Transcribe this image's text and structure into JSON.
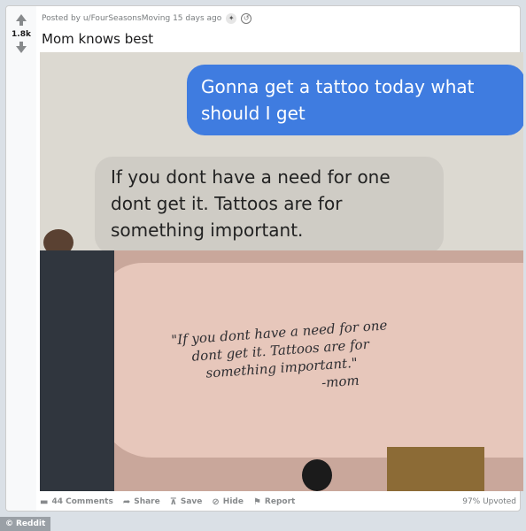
{
  "post": {
    "meta": "Posted by u/FourSeasonsMoving 15 days ago",
    "score": "1.8k",
    "title": "Mom knows best"
  },
  "media": {
    "sent_message": "Gonna get a tattoo today what should I get",
    "received_message": "If you dont have a need for one dont get it. Tattoos are for something important.",
    "tattoo_lines": [
      "\"If you dont have a need for one",
      "dont get it. Tattoos are for",
      "something important.\""
    ],
    "tattoo_signature": "-mom"
  },
  "actions": {
    "comments": "44 Comments",
    "share": "Share",
    "save": "Save",
    "hide": "Hide",
    "report": "Report",
    "upvoted": "97% Upvoted"
  },
  "footer": {
    "brand": "Reddit"
  },
  "icons": [
    "upvote-icon",
    "downvote-icon",
    "award-icon",
    "comment-icon",
    "share-icon",
    "save-icon",
    "hide-icon",
    "report-icon",
    "copyright-icon"
  ]
}
